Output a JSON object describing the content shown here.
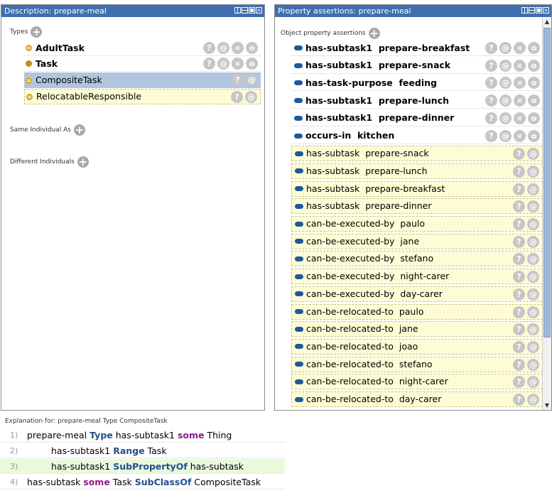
{
  "left_panel": {
    "title": "Description: prepare-meal",
    "types_label": "Types",
    "types": [
      {
        "label": "AdultTask",
        "bold": true,
        "icon": "equivalent-class-icon",
        "buttons": 4
      },
      {
        "label": "Task",
        "bold": true,
        "icon": "class-icon",
        "buttons": 4
      },
      {
        "label": "CompositeTask",
        "selected": true,
        "icon": "equivalent-class-icon",
        "buttons": 2
      },
      {
        "label": "RelocatableResponsible",
        "inferred": true,
        "icon": "equivalent-class-icon",
        "buttons": 2
      }
    ],
    "same_individual_label": "Same Individual As",
    "different_individuals_label": "Different Individuals"
  },
  "right_panel": {
    "title": "Property assertions: prepare-meal",
    "object_props_label": "Object property assertions",
    "assertions": [
      {
        "label": "has-subtask1  prepare-breakfast",
        "bold": true
      },
      {
        "label": "has-subtask1  prepare-snack",
        "bold": true
      },
      {
        "label": "has-task-purpose  feeding",
        "bold": true
      },
      {
        "label": "has-subtask1  prepare-lunch",
        "bold": true
      },
      {
        "label": "has-subtask1  prepare-dinner",
        "bold": true
      },
      {
        "label": "occurs-in  kitchen",
        "bold": true
      },
      {
        "label": "has-subtask  prepare-snack",
        "bold": false
      },
      {
        "label": "has-subtask  prepare-lunch",
        "bold": false
      },
      {
        "label": "has-subtask  prepare-breakfast",
        "bold": false
      },
      {
        "label": "has-subtask  prepare-dinner",
        "bold": false
      },
      {
        "label": "can-be-executed-by  paulo",
        "bold": false
      },
      {
        "label": "can-be-executed-by  jane",
        "bold": false
      },
      {
        "label": "can-be-executed-by  stefano",
        "bold": false
      },
      {
        "label": "can-be-executed-by  night-carer",
        "bold": false
      },
      {
        "label": "can-be-executed-by  day-carer",
        "bold": false
      },
      {
        "label": "can-be-relocated-to  paulo",
        "bold": false
      },
      {
        "label": "can-be-relocated-to  jane",
        "bold": false
      },
      {
        "label": "can-be-relocated-to  joao",
        "bold": false
      },
      {
        "label": "can-be-relocated-to  stefano",
        "bold": false
      },
      {
        "label": "can-be-relocated-to  night-carer",
        "bold": false
      },
      {
        "label": "can-be-relocated-to  day-carer",
        "bold": false
      }
    ]
  },
  "explanation": {
    "title": "Explanation for: prepare-meal Type CompositeTask",
    "lines": [
      {
        "num": "1)",
        "indent": 0,
        "highlight": false,
        "parts": [
          {
            "t": "prepare-meal "
          },
          {
            "t": "Type",
            "k": "blue"
          },
          {
            "t": " has-subtask1 "
          },
          {
            "t": "some",
            "k": "purple"
          },
          {
            "t": " Thing"
          }
        ]
      },
      {
        "num": "2)",
        "indent": 1,
        "highlight": false,
        "parts": [
          {
            "t": "has-subtask1 "
          },
          {
            "t": "Range",
            "k": "blue"
          },
          {
            "t": " Task"
          }
        ]
      },
      {
        "num": "3)",
        "indent": 1,
        "highlight": true,
        "parts": [
          {
            "t": "has-subtask1 "
          },
          {
            "t": "SubPropertyOf",
            "k": "blue"
          },
          {
            "t": " has-subtask"
          }
        ]
      },
      {
        "num": "4)",
        "indent": 0,
        "highlight": false,
        "parts": [
          {
            "t": "has-subtask "
          },
          {
            "t": "some",
            "k": "purple"
          },
          {
            "t": " Task "
          },
          {
            "t": "SubClassOf",
            "k": "blue"
          },
          {
            "t": " CompositeTask"
          }
        ]
      }
    ]
  },
  "button_glyphs": {
    "help": "?",
    "annotate": "@",
    "delete": "×",
    "edit": "o"
  },
  "colors": {
    "header": "#3f6fae",
    "selected": "#b1c6de",
    "inferred": "#fdfcd4",
    "property": "#1d5a9a",
    "class": "#d9a628"
  }
}
